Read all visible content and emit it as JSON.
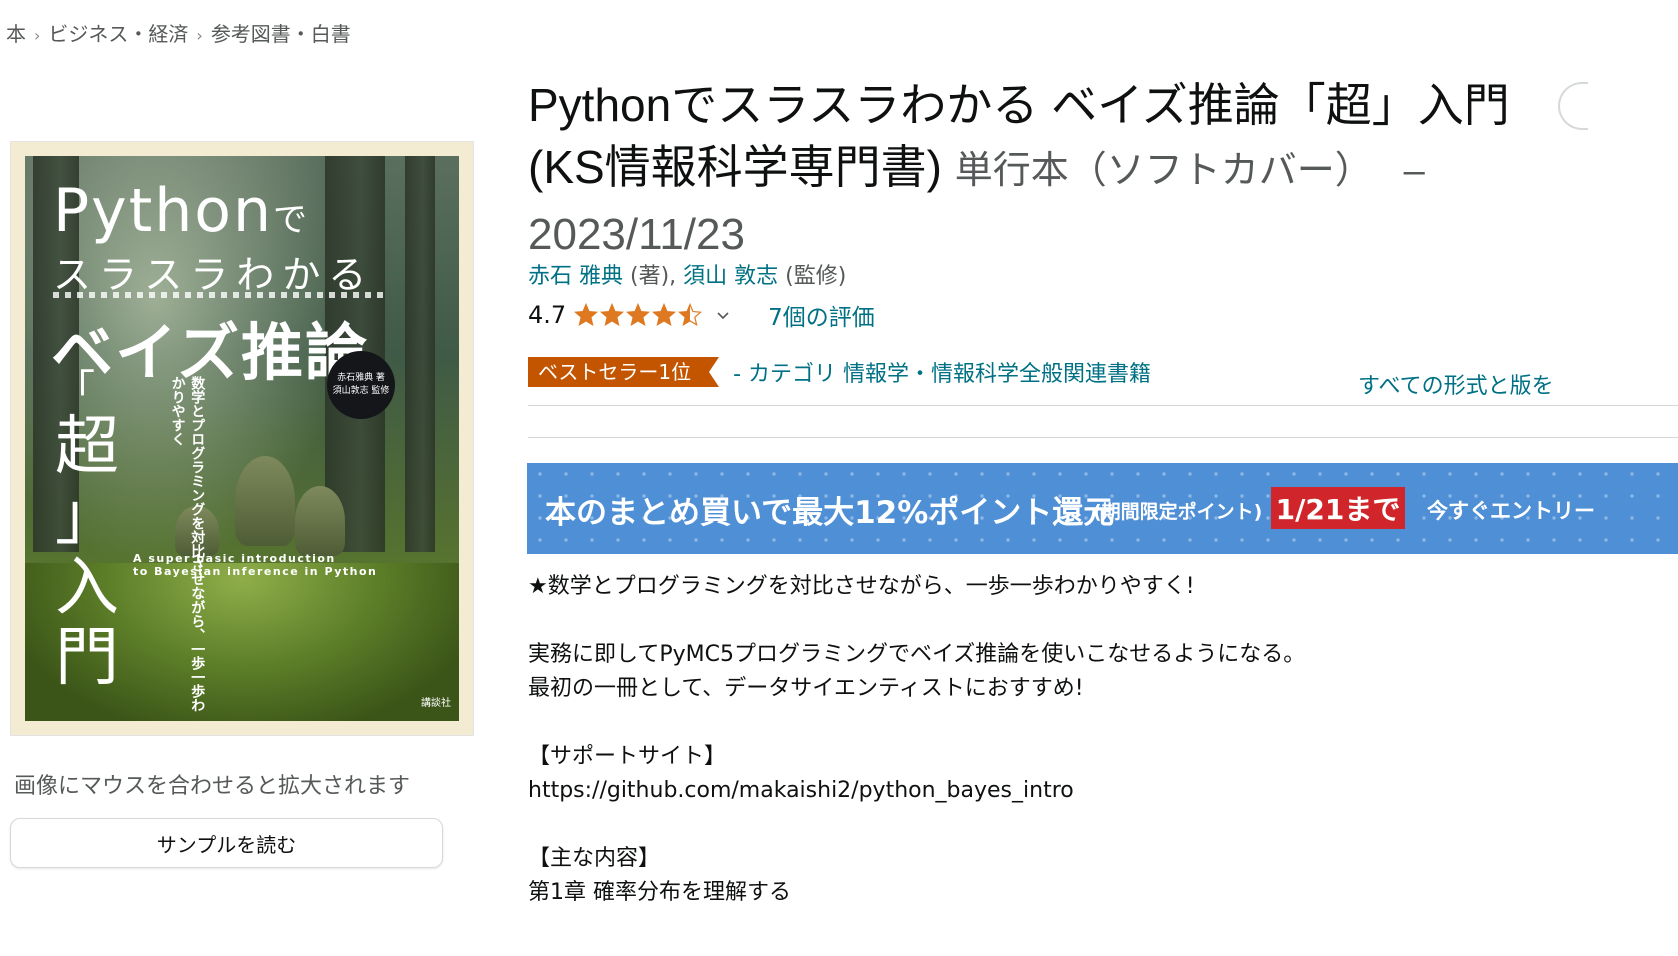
{
  "breadcrumb": [
    "本",
    "ビジネス・経済",
    "参考図書・白書"
  ],
  "cover": {
    "title_en": "Python",
    "title_de": "で",
    "title_jp1": "スラスラわかる",
    "title_jp2": "ベイズ推論",
    "title_vert": [
      "「",
      "超",
      "」入",
      "門"
    ],
    "subtitle_vertical": "数学とプログラミングを対比させながら、一歩一歩わかりやすく",
    "badge_line1": "赤石雅典 著",
    "badge_line2": "須山敦志 監修",
    "english_line1": "A super basic introduction",
    "english_line2": "to Bayesian inference in Python",
    "publisher": "講談社"
  },
  "hover_hint": "画像にマウスを合わせると拡大されます",
  "sample_button": "サンプルを読む",
  "product": {
    "title_line1": "Pythonでスラスラわかる ベイズ推論「超」入門",
    "title_line2": "(KS情報科学専門書)",
    "format": "単行本（ソフトカバー）",
    "dash": "–",
    "date": "2023/11/23"
  },
  "authors": {
    "author1": "赤石 雅典",
    "role1": "(著),",
    "author2": "須山 敦志",
    "role2": "(監修)"
  },
  "rating": {
    "value": "4.7",
    "stars_filled": 4.5,
    "reviews": "7個の評価"
  },
  "bestseller": {
    "badge": "ベストセラー1位",
    "category": "- カテゴリ 情報学・情報科学全般関連書籍"
  },
  "all_formats_link": "すべての形式と版を",
  "banner": {
    "main": "本のまとめ買いで最大12%ポイント還元",
    "note": "(期間限定ポイント)",
    "date": "1/21まで",
    "cta": "今すぐエントリー"
  },
  "description": {
    "line1": "★数学とプログラミングを対比させながら、一歩一歩わかりやすく!",
    "line2": "実務に即してPyMC5プログラミングでベイズ推論を使いこなせるようになる。",
    "line3": "最初の一冊として、データサイエンティストにおすすめ!",
    "line4": "【サポートサイト】",
    "line5": "https://github.com/makaishi2/python_bayes_intro",
    "line6": "【主な内容】",
    "line7": "第1章 確率分布を理解する"
  },
  "colors": {
    "link": "#007185",
    "star": "#de7921",
    "bestseller": "#c45500",
    "banner": "#4e8fd6",
    "banner_date": "#d0262b"
  }
}
